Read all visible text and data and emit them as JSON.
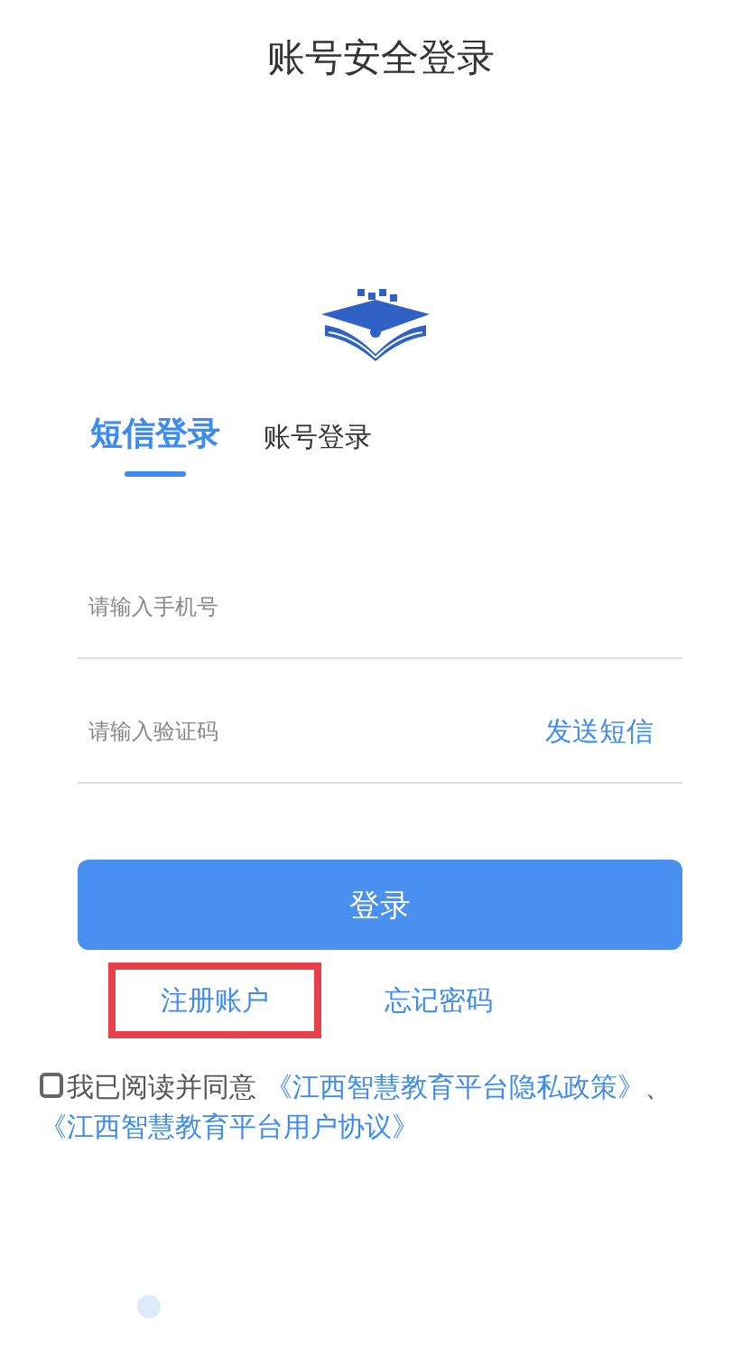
{
  "header": {
    "title": "账号安全登录"
  },
  "tabs": [
    {
      "label": "短信登录",
      "selected": true
    },
    {
      "label": "账号登录",
      "selected": false
    }
  ],
  "fields": [
    {
      "placeholder": "请输入手机号"
    },
    {
      "placeholder": "请输入验证码",
      "action": "发送短信"
    }
  ],
  "login_button": "登录",
  "links": [
    {
      "label": "注册账户",
      "highlighted": true
    },
    {
      "label": "忘记密码",
      "highlighted": false
    }
  ],
  "agreement": {
    "checked": false,
    "text": "我已阅读并同意",
    "policies": [
      "《江西智慧教育平台隐私政策》",
      "《江西智慧教育平台用户协议》"
    ],
    "separator": "、"
  }
}
